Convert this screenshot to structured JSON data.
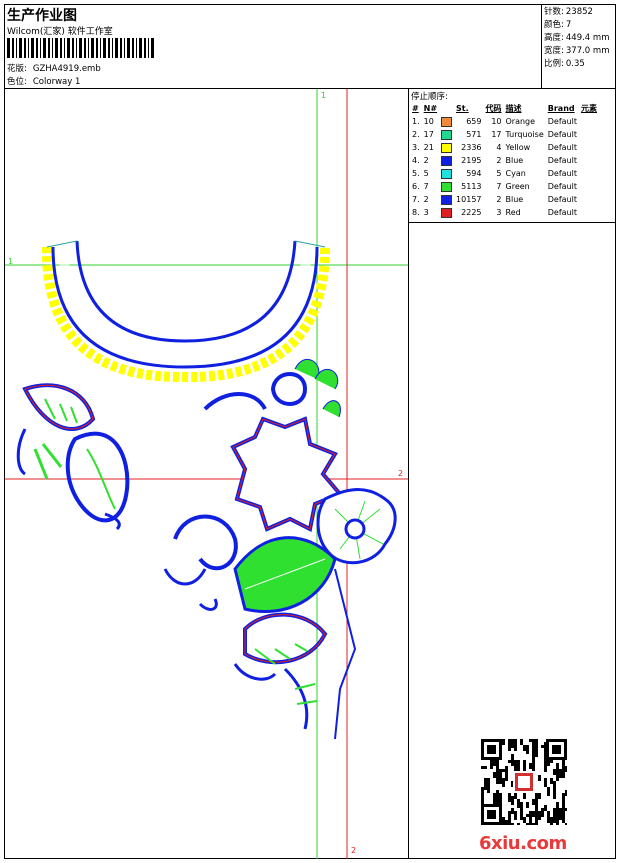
{
  "header": {
    "title": "生产作业图",
    "company": "Wilcom(汇家) 软件工作室",
    "design_label": "花版:",
    "design_value": "GZHA4919.emb",
    "colorway_label": "色位:",
    "colorway_value": "Colorway 1"
  },
  "stats": [
    {
      "label": "针数:",
      "value": "23852"
    },
    {
      "label": "颜色:",
      "value": "7"
    },
    {
      "label": "高度:",
      "value": "449.4 mm"
    },
    {
      "label": "宽度:",
      "value": "377.0 mm"
    },
    {
      "label": "比例:",
      "value": "0.35"
    }
  ],
  "stop_table": {
    "title": "停止顺序:",
    "headers": [
      "#",
      "N#",
      "St.",
      "代码",
      "描述",
      "Brand",
      "元素"
    ],
    "rows": [
      {
        "idx": "1.",
        "n": "10",
        "color": "#f08a3c",
        "st": "659",
        "code": "10",
        "desc": "Orange",
        "brand": "Default"
      },
      {
        "idx": "2.",
        "n": "17",
        "color": "#20d890",
        "st": "571",
        "code": "17",
        "desc": "Turquoise",
        "brand": "Default"
      },
      {
        "idx": "3.",
        "n": "21",
        "color": "#ffff00",
        "st": "2336",
        "code": "4",
        "desc": "Yellow",
        "brand": "Default"
      },
      {
        "idx": "4.",
        "n": "2",
        "color": "#1020e0",
        "st": "2195",
        "code": "2",
        "desc": "Blue",
        "brand": "Default"
      },
      {
        "idx": "5.",
        "n": "5",
        "color": "#20e0e0",
        "st": "594",
        "code": "5",
        "desc": "Cyan",
        "brand": "Default"
      },
      {
        "idx": "6.",
        "n": "7",
        "color": "#30e030",
        "st": "5113",
        "code": "7",
        "desc": "Green",
        "brand": "Default"
      },
      {
        "idx": "7.",
        "n": "2",
        "color": "#1020e0",
        "st": "10157",
        "code": "2",
        "desc": "Blue",
        "brand": "Default"
      },
      {
        "idx": "8.",
        "n": "3",
        "color": "#e02020",
        "st": "2225",
        "code": "3",
        "desc": "Red",
        "brand": "Default"
      }
    ]
  },
  "guides": {
    "v1": "1",
    "h1": "1",
    "h2": "2",
    "v2": "2"
  },
  "watermark": "6xiu.com",
  "colors": {
    "green_guide": "#30d030",
    "red_guide": "#e02020",
    "blue": "#1020e0",
    "yellow": "#ffff00",
    "red_outline": "#e02020",
    "green": "#30e030",
    "watermark": "#e83a3a"
  }
}
